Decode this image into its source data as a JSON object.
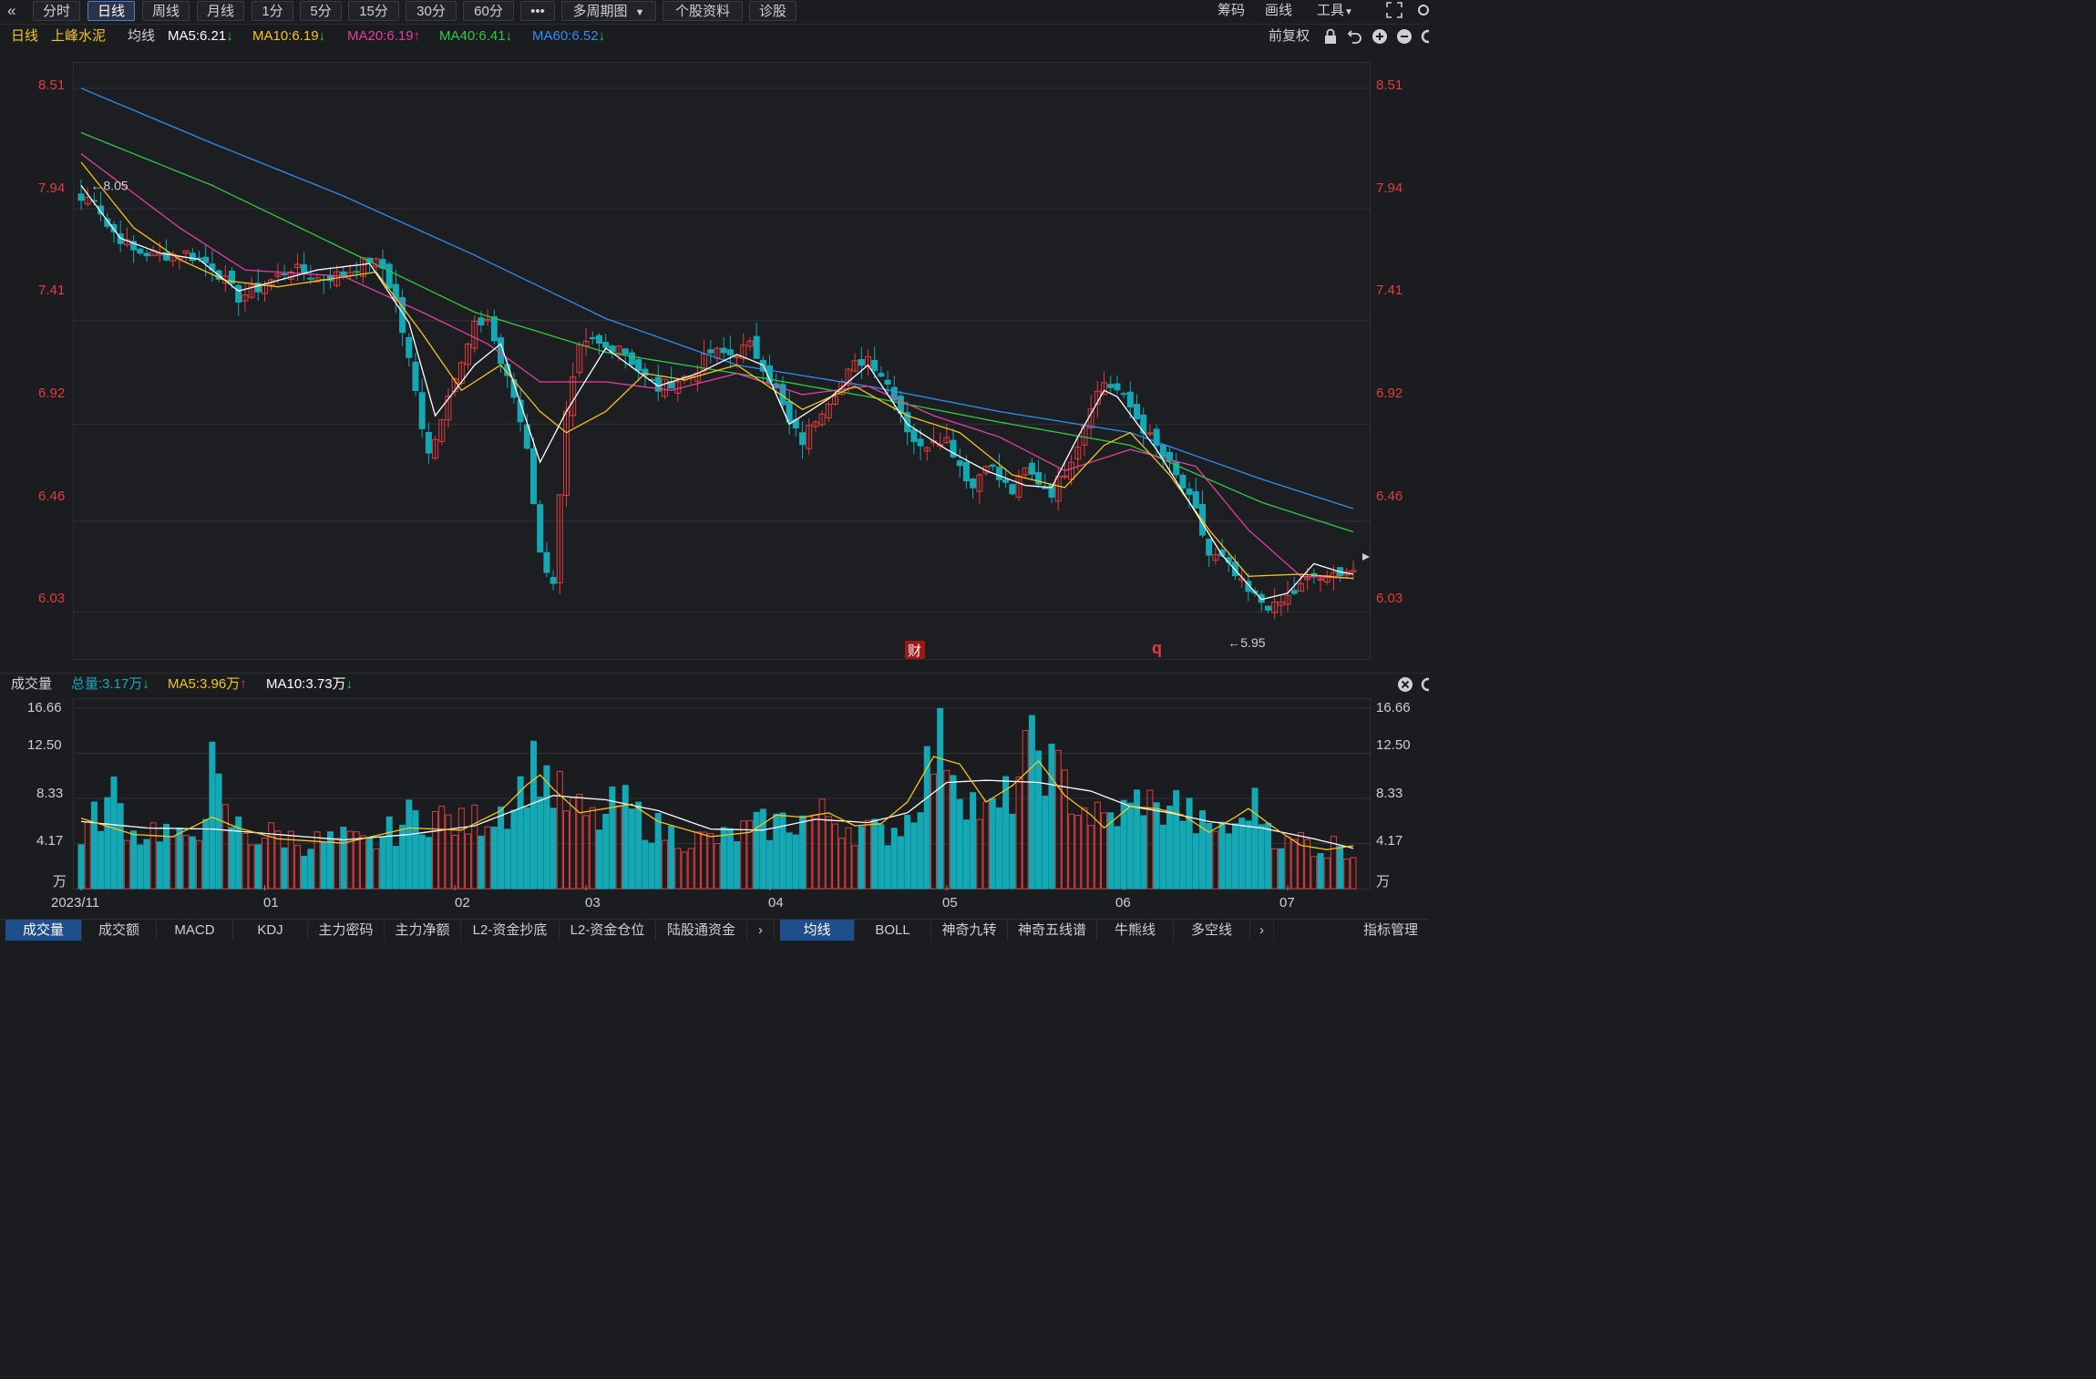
{
  "toolbar": {
    "collapse_icon": "double-chevron-left-icon",
    "periods": [
      "分时",
      "日线",
      "周线",
      "月线",
      "1分",
      "5分",
      "15分",
      "30分",
      "60分"
    ],
    "active_period": "日线",
    "more_label": "•••",
    "multi_period": "多周期图",
    "stock_info": "个股资料",
    "diagnose": "诊股",
    "right": {
      "chips": "筹码",
      "draw": "画线",
      "tools": "工具"
    },
    "icons": [
      "fullscreen-icon",
      "settings-icon"
    ]
  },
  "ma_bar": {
    "period": "日线",
    "stock_name": "上峰水泥",
    "avg_label": "均线",
    "ma5": "MA5:6.21",
    "ma10": "MA10:6.19",
    "ma20": "MA20:6.19",
    "ma40": "MA40:6.41",
    "ma60": "MA60:6.52",
    "ma5_dir": "↓",
    "ma10_dir": "↓",
    "ma20_dir": "↑",
    "ma40_dir": "↓",
    "ma60_dir": "↓",
    "restore": "前复权",
    "icons": [
      "lock-icon",
      "undo-icon",
      "zoom-in-icon",
      "zoom-out-icon",
      "settings-icon"
    ]
  },
  "colors": {
    "up": "#e23c3c",
    "down": "#14a8b4",
    "ma5": "#ffffff",
    "ma10": "#f5c518",
    "ma20": "#e040a0",
    "ma40": "#2ecc40",
    "ma60": "#2f8ff0",
    "background": "#1b1c20",
    "grid": "#2e3036"
  },
  "markers": {
    "high_label": "←8.05",
    "low_label": "←5.95",
    "fin_badge": "财",
    "q_badge": "q"
  },
  "volume_bar": {
    "title": "成交量",
    "total": "总量:3.17万",
    "ma5": "MA5:3.96万",
    "ma10": "MA10:3.73万",
    "total_dir": "↓",
    "ma5_dir": "↑",
    "ma10_dir": "↓",
    "close_icon": "close-icon"
  },
  "bottom_tabs": {
    "left": [
      "成交量",
      "成交额",
      "MACD",
      "KDJ",
      "主力密码",
      "主力净额",
      "L2-资金抄底",
      "L2-资金仓位",
      "陆股通资金"
    ],
    "right": [
      "均线",
      "BOLL",
      "神奇九转",
      "神奇五线谱",
      "牛熊线",
      "多空线"
    ],
    "manage": "指标管理",
    "active_left": "成交量",
    "active_right": "均线"
  },
  "chart_data": {
    "type": "candlestick",
    "title": "",
    "xlabel": "",
    "ylabel": "",
    "y_ticks": [
      8.51,
      7.94,
      7.41,
      6.92,
      6.46,
      6.03
    ],
    "ylim": [
      5.8,
      8.63
    ],
    "x_ticks": [
      "2023/11",
      "01",
      "02",
      "03",
      "04",
      "05",
      "06",
      "07"
    ],
    "x_tick_index": [
      0,
      28,
      57,
      77,
      105,
      132,
      159,
      184
    ],
    "n_bars": 195,
    "price_anchors": [
      [
        0,
        7.98
      ],
      [
        2,
        8.0
      ],
      [
        4,
        7.86
      ],
      [
        8,
        7.74
      ],
      [
        12,
        7.72
      ],
      [
        16,
        7.73
      ],
      [
        20,
        7.67
      ],
      [
        24,
        7.52
      ],
      [
        28,
        7.58
      ],
      [
        32,
        7.66
      ],
      [
        36,
        7.61
      ],
      [
        40,
        7.63
      ],
      [
        44,
        7.7
      ],
      [
        46,
        7.66
      ],
      [
        48,
        7.5
      ],
      [
        50,
        7.22
      ],
      [
        52,
        6.92
      ],
      [
        53,
        6.8
      ],
      [
        54,
        6.85
      ],
      [
        56,
        7.08
      ],
      [
        58,
        7.2
      ],
      [
        60,
        7.38
      ],
      [
        62,
        7.42
      ],
      [
        64,
        7.21
      ],
      [
        66,
        7.05
      ],
      [
        68,
        6.82
      ],
      [
        70,
        6.3
      ],
      [
        72,
        6.18
      ],
      [
        74,
        6.96
      ],
      [
        76,
        7.27
      ],
      [
        78,
        7.31
      ],
      [
        80,
        7.28
      ],
      [
        82,
        7.3
      ],
      [
        84,
        7.22
      ],
      [
        86,
        7.14
      ],
      [
        88,
        7.09
      ],
      [
        90,
        7.12
      ],
      [
        93,
        7.15
      ],
      [
        96,
        7.26
      ],
      [
        99,
        7.25
      ],
      [
        102,
        7.29
      ],
      [
        104,
        7.2
      ],
      [
        106,
        7.08
      ],
      [
        108,
        6.92
      ],
      [
        110,
        6.84
      ],
      [
        112,
        6.95
      ],
      [
        114,
        7.04
      ],
      [
        116,
        7.12
      ],
      [
        118,
        7.2
      ],
      [
        120,
        7.24
      ],
      [
        122,
        7.16
      ],
      [
        124,
        7.06
      ],
      [
        126,
        6.9
      ],
      [
        128,
        6.8
      ],
      [
        130,
        6.86
      ],
      [
        132,
        6.85
      ],
      [
        134,
        6.73
      ],
      [
        136,
        6.62
      ],
      [
        138,
        6.75
      ],
      [
        140,
        6.66
      ],
      [
        142,
        6.6
      ],
      [
        144,
        6.7
      ],
      [
        146,
        6.65
      ],
      [
        148,
        6.6
      ],
      [
        150,
        6.7
      ],
      [
        152,
        6.83
      ],
      [
        154,
        7.02
      ],
      [
        156,
        7.12
      ],
      [
        158,
        7.08
      ],
      [
        160,
        7.0
      ],
      [
        162,
        6.9
      ],
      [
        164,
        6.81
      ],
      [
        166,
        6.72
      ],
      [
        168,
        6.62
      ],
      [
        170,
        6.5
      ],
      [
        172,
        6.3
      ],
      [
        174,
        6.28
      ],
      [
        176,
        6.2
      ],
      [
        178,
        6.12
      ],
      [
        180,
        6.08
      ],
      [
        182,
        6.05
      ],
      [
        184,
        6.1
      ],
      [
        186,
        6.15
      ],
      [
        188,
        6.2
      ],
      [
        190,
        6.18
      ],
      [
        192,
        6.23
      ],
      [
        194,
        6.23
      ]
    ],
    "ma60_anchors": [
      [
        0,
        8.51
      ],
      [
        20,
        8.25
      ],
      [
        40,
        8.0
      ],
      [
        60,
        7.72
      ],
      [
        80,
        7.42
      ],
      [
        100,
        7.2
      ],
      [
        120,
        7.1
      ],
      [
        140,
        6.98
      ],
      [
        160,
        6.88
      ],
      [
        180,
        6.66
      ],
      [
        194,
        6.52
      ]
    ],
    "ma40_anchors": [
      [
        0,
        8.3
      ],
      [
        20,
        8.05
      ],
      [
        40,
        7.75
      ],
      [
        60,
        7.45
      ],
      [
        80,
        7.26
      ],
      [
        100,
        7.16
      ],
      [
        120,
        7.05
      ],
      [
        140,
        6.93
      ],
      [
        160,
        6.82
      ],
      [
        180,
        6.55
      ],
      [
        194,
        6.41
      ]
    ],
    "ma20_anchors": [
      [
        0,
        8.2
      ],
      [
        15,
        7.85
      ],
      [
        25,
        7.65
      ],
      [
        40,
        7.62
      ],
      [
        52,
        7.45
      ],
      [
        62,
        7.3
      ],
      [
        70,
        7.12
      ],
      [
        80,
        7.12
      ],
      [
        90,
        7.08
      ],
      [
        100,
        7.16
      ],
      [
        110,
        7.06
      ],
      [
        120,
        7.1
      ],
      [
        130,
        6.96
      ],
      [
        140,
        6.86
      ],
      [
        150,
        6.7
      ],
      [
        160,
        6.8
      ],
      [
        170,
        6.72
      ],
      [
        178,
        6.42
      ],
      [
        186,
        6.2
      ],
      [
        194,
        6.19
      ]
    ],
    "ma10_anchors": [
      [
        0,
        8.16
      ],
      [
        8,
        7.85
      ],
      [
        15,
        7.7
      ],
      [
        22,
        7.6
      ],
      [
        30,
        7.57
      ],
      [
        45,
        7.64
      ],
      [
        52,
        7.35
      ],
      [
        58,
        7.08
      ],
      [
        64,
        7.2
      ],
      [
        70,
        6.98
      ],
      [
        74,
        6.88
      ],
      [
        80,
        6.98
      ],
      [
        86,
        7.16
      ],
      [
        92,
        7.13
      ],
      [
        100,
        7.2
      ],
      [
        110,
        6.99
      ],
      [
        118,
        7.1
      ],
      [
        126,
        6.96
      ],
      [
        134,
        6.88
      ],
      [
        142,
        6.68
      ],
      [
        150,
        6.62
      ],
      [
        156,
        6.82
      ],
      [
        160,
        6.88
      ],
      [
        166,
        6.68
      ],
      [
        172,
        6.42
      ],
      [
        178,
        6.2
      ],
      [
        186,
        6.21
      ],
      [
        194,
        6.19
      ]
    ],
    "ma5_anchors": [
      [
        0,
        8.05
      ],
      [
        6,
        7.8
      ],
      [
        12,
        7.73
      ],
      [
        18,
        7.7
      ],
      [
        24,
        7.55
      ],
      [
        30,
        7.6
      ],
      [
        36,
        7.65
      ],
      [
        44,
        7.68
      ],
      [
        50,
        7.4
      ],
      [
        54,
        6.96
      ],
      [
        60,
        7.2
      ],
      [
        64,
        7.3
      ],
      [
        70,
        6.74
      ],
      [
        74,
        6.98
      ],
      [
        80,
        7.28
      ],
      [
        88,
        7.1
      ],
      [
        94,
        7.16
      ],
      [
        100,
        7.25
      ],
      [
        104,
        7.2
      ],
      [
        108,
        6.92
      ],
      [
        114,
        7.04
      ],
      [
        120,
        7.2
      ],
      [
        126,
        6.92
      ],
      [
        132,
        6.8
      ],
      [
        138,
        6.7
      ],
      [
        144,
        6.63
      ],
      [
        148,
        6.62
      ],
      [
        152,
        6.86
      ],
      [
        156,
        7.08
      ],
      [
        158,
        7.05
      ],
      [
        164,
        6.8
      ],
      [
        168,
        6.6
      ],
      [
        174,
        6.3
      ],
      [
        180,
        6.09
      ],
      [
        184,
        6.12
      ],
      [
        188,
        6.26
      ],
      [
        192,
        6.22
      ],
      [
        194,
        6.21
      ]
    ],
    "high": {
      "index": 2,
      "value": 8.05
    },
    "low": {
      "index": 175,
      "value": 5.95
    },
    "volume": {
      "unit": "万",
      "y_ticks": [
        16.66,
        12.5,
        8.33,
        4.17
      ],
      "ylim": [
        0,
        16.66
      ],
      "anchors": [
        [
          0,
          5.0
        ],
        [
          3,
          7.0
        ],
        [
          5,
          8.6
        ],
        [
          8,
          5.0
        ],
        [
          12,
          5.6
        ],
        [
          16,
          4.0
        ],
        [
          18,
          6.0
        ],
        [
          20,
          10.8
        ],
        [
          22,
          6.5
        ],
        [
          26,
          4.8
        ],
        [
          30,
          5.0
        ],
        [
          34,
          4.2
        ],
        [
          40,
          4.5
        ],
        [
          44,
          4.0
        ],
        [
          48,
          5.5
        ],
        [
          50,
          6.5
        ],
        [
          54,
          6.8
        ],
        [
          58,
          5.8
        ],
        [
          60,
          6.2
        ],
        [
          64,
          7.5
        ],
        [
          66,
          8.0
        ],
        [
          68,
          10.5
        ],
        [
          70,
          11.6
        ],
        [
          72,
          9.0
        ],
        [
          74,
          7.8
        ],
        [
          76,
          7.0
        ],
        [
          78,
          6.2
        ],
        [
          80,
          6.5
        ],
        [
          82,
          8.0
        ],
        [
          84,
          7.0
        ],
        [
          86,
          6.2
        ],
        [
          88,
          5.5
        ],
        [
          90,
          5.0
        ],
        [
          94,
          4.5
        ],
        [
          98,
          4.6
        ],
        [
          102,
          5.5
        ],
        [
          106,
          6.0
        ],
        [
          110,
          6.4
        ],
        [
          114,
          6.8
        ],
        [
          118,
          5.6
        ],
        [
          122,
          5.0
        ],
        [
          126,
          6.4
        ],
        [
          128,
          9.5
        ],
        [
          130,
          12.5
        ],
        [
          132,
          13.8
        ],
        [
          134,
          10.0
        ],
        [
          136,
          8.0
        ],
        [
          138,
          6.8
        ],
        [
          140,
          7.2
        ],
        [
          142,
          9.0
        ],
        [
          144,
          11.8
        ],
        [
          146,
          13.0
        ],
        [
          148,
          11.0
        ],
        [
          150,
          9.5
        ],
        [
          152,
          8.0
        ],
        [
          154,
          6.8
        ],
        [
          156,
          6.2
        ],
        [
          158,
          6.8
        ],
        [
          160,
          7.2
        ],
        [
          162,
          8.8
        ],
        [
          164,
          6.8
        ],
        [
          166,
          8.2
        ],
        [
          168,
          7.2
        ],
        [
          170,
          6.2
        ],
        [
          172,
          5.2
        ],
        [
          174,
          6.0
        ],
        [
          176,
          5.0
        ],
        [
          178,
          8.0
        ],
        [
          180,
          7.0
        ],
        [
          182,
          5.2
        ],
        [
          184,
          4.0
        ],
        [
          186,
          4.6
        ],
        [
          188,
          4.0
        ],
        [
          190,
          3.5
        ],
        [
          192,
          4.5
        ],
        [
          194,
          3.17
        ]
      ],
      "ma5_anchors": [
        [
          0,
          6.5
        ],
        [
          8,
          5.0
        ],
        [
          14,
          4.8
        ],
        [
          20,
          6.6
        ],
        [
          24,
          5.6
        ],
        [
          30,
          4.6
        ],
        [
          40,
          4.2
        ],
        [
          50,
          5.6
        ],
        [
          58,
          5.4
        ],
        [
          64,
          7.2
        ],
        [
          68,
          9.6
        ],
        [
          70,
          10.5
        ],
        [
          72,
          9.2
        ],
        [
          76,
          7.0
        ],
        [
          80,
          7.4
        ],
        [
          84,
          7.8
        ],
        [
          88,
          6.2
        ],
        [
          96,
          4.8
        ],
        [
          102,
          5.2
        ],
        [
          106,
          6.8
        ],
        [
          110,
          6.6
        ],
        [
          114,
          7.0
        ],
        [
          118,
          5.8
        ],
        [
          122,
          6.0
        ],
        [
          126,
          8.0
        ],
        [
          130,
          12.2
        ],
        [
          134,
          11.5
        ],
        [
          138,
          8.0
        ],
        [
          142,
          9.5
        ],
        [
          146,
          11.8
        ],
        [
          150,
          8.6
        ],
        [
          154,
          6.8
        ],
        [
          156,
          5.6
        ],
        [
          160,
          7.6
        ],
        [
          164,
          7.4
        ],
        [
          168,
          6.8
        ],
        [
          172,
          5.2
        ],
        [
          176,
          6.6
        ],
        [
          178,
          7.4
        ],
        [
          182,
          5.6
        ],
        [
          186,
          4.0
        ],
        [
          190,
          3.6
        ],
        [
          194,
          3.96
        ]
      ],
      "ma10_anchors": [
        [
          0,
          6.2
        ],
        [
          10,
          5.6
        ],
        [
          20,
          5.5
        ],
        [
          30,
          5.0
        ],
        [
          40,
          4.5
        ],
        [
          50,
          5.0
        ],
        [
          60,
          5.8
        ],
        [
          66,
          7.2
        ],
        [
          72,
          8.6
        ],
        [
          80,
          8.2
        ],
        [
          88,
          7.2
        ],
        [
          96,
          5.5
        ],
        [
          104,
          5.4
        ],
        [
          112,
          6.4
        ],
        [
          120,
          6.1
        ],
        [
          126,
          7.0
        ],
        [
          132,
          9.8
        ],
        [
          138,
          10.0
        ],
        [
          146,
          9.8
        ],
        [
          154,
          9.0
        ],
        [
          160,
          7.6
        ],
        [
          166,
          7.0
        ],
        [
          172,
          6.2
        ],
        [
          180,
          5.6
        ],
        [
          188,
          4.6
        ],
        [
          194,
          3.73
        ]
      ]
    },
    "grid": true,
    "legend": "top-left"
  }
}
